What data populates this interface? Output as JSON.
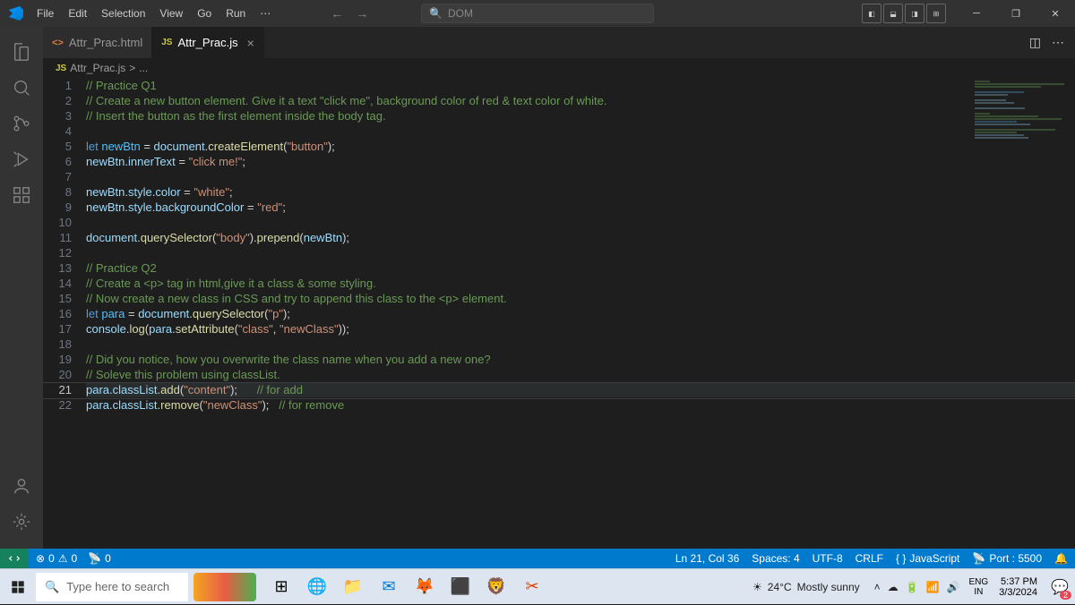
{
  "menu": [
    "File",
    "Edit",
    "Selection",
    "View",
    "Go",
    "Run"
  ],
  "search_placeholder": "DOM",
  "tabs": [
    {
      "icon": "html",
      "label": "Attr_Prac.html",
      "active": false
    },
    {
      "icon": "js",
      "label": "Attr_Prac.js",
      "active": true
    }
  ],
  "breadcrumb": {
    "file": "Attr_Prac.js",
    "sep": ">",
    "rest": "..."
  },
  "code": {
    "lines": [
      {
        "n": 1,
        "t": [
          [
            "cm",
            "// Practice Q1"
          ]
        ]
      },
      {
        "n": 2,
        "t": [
          [
            "cm",
            "// Create a new button element. Give it a text \"click me\", background color of red & text color of white."
          ]
        ]
      },
      {
        "n": 3,
        "t": [
          [
            "cm",
            "// Insert the button as the first element inside the body tag."
          ]
        ]
      },
      {
        "n": 4,
        "t": []
      },
      {
        "n": 5,
        "t": [
          [
            "kw",
            "let "
          ],
          [
            "lv",
            "newBtn"
          ],
          [
            "op",
            " = "
          ],
          [
            "vr",
            "document"
          ],
          [
            "pn",
            "."
          ],
          [
            "fn",
            "createElement"
          ],
          [
            "pn",
            "("
          ],
          [
            "st",
            "\"button\""
          ],
          [
            "pn",
            ");"
          ]
        ]
      },
      {
        "n": 6,
        "t": [
          [
            "vr",
            "newBtn"
          ],
          [
            "pn",
            "."
          ],
          [
            "vr",
            "innerText"
          ],
          [
            "op",
            " = "
          ],
          [
            "st",
            "\"click me!\""
          ],
          [
            "pn",
            ";"
          ]
        ]
      },
      {
        "n": 7,
        "t": []
      },
      {
        "n": 8,
        "t": [
          [
            "vr",
            "newBtn"
          ],
          [
            "pn",
            "."
          ],
          [
            "vr",
            "style"
          ],
          [
            "pn",
            "."
          ],
          [
            "vr",
            "color"
          ],
          [
            "op",
            " = "
          ],
          [
            "st",
            "\"white\""
          ],
          [
            "pn",
            ";"
          ]
        ]
      },
      {
        "n": 9,
        "t": [
          [
            "vr",
            "newBtn"
          ],
          [
            "pn",
            "."
          ],
          [
            "vr",
            "style"
          ],
          [
            "pn",
            "."
          ],
          [
            "vr",
            "backgroundColor"
          ],
          [
            "op",
            " = "
          ],
          [
            "st",
            "\"red\""
          ],
          [
            "pn",
            ";"
          ]
        ]
      },
      {
        "n": 10,
        "t": []
      },
      {
        "n": 11,
        "t": [
          [
            "vr",
            "document"
          ],
          [
            "pn",
            "."
          ],
          [
            "fn",
            "querySelector"
          ],
          [
            "pn",
            "("
          ],
          [
            "st",
            "\"body\""
          ],
          [
            "pn",
            ")."
          ],
          [
            "fn",
            "prepend"
          ],
          [
            "pn",
            "("
          ],
          [
            "vr",
            "newBtn"
          ],
          [
            "pn",
            ");"
          ]
        ]
      },
      {
        "n": 12,
        "t": []
      },
      {
        "n": 13,
        "t": [
          [
            "cm",
            "// Practice Q2"
          ]
        ]
      },
      {
        "n": 14,
        "t": [
          [
            "cm",
            "// Create a <p> tag in html,give it a class & some styling."
          ]
        ]
      },
      {
        "n": 15,
        "t": [
          [
            "cm",
            "// Now create a new class in CSS and try to append this class to the <p> element."
          ]
        ]
      },
      {
        "n": 16,
        "t": [
          [
            "kw",
            "let "
          ],
          [
            "lv",
            "para"
          ],
          [
            "op",
            " = "
          ],
          [
            "vr",
            "document"
          ],
          [
            "pn",
            "."
          ],
          [
            "fn",
            "querySelector"
          ],
          [
            "pn",
            "("
          ],
          [
            "st",
            "\"p\""
          ],
          [
            "pn",
            ");"
          ]
        ]
      },
      {
        "n": 17,
        "t": [
          [
            "vr",
            "console"
          ],
          [
            "pn",
            "."
          ],
          [
            "fn",
            "log"
          ],
          [
            "pn",
            "("
          ],
          [
            "vr",
            "para"
          ],
          [
            "pn",
            "."
          ],
          [
            "fn",
            "setAttribute"
          ],
          [
            "pn",
            "("
          ],
          [
            "st",
            "\"class\""
          ],
          [
            "pn",
            ", "
          ],
          [
            "st",
            "\"newClass\""
          ],
          [
            "pn",
            "));"
          ]
        ]
      },
      {
        "n": 18,
        "t": []
      },
      {
        "n": 19,
        "t": [
          [
            "cm",
            "// Did you notice, how you overwrite the class name when you add a new one?"
          ]
        ]
      },
      {
        "n": 20,
        "t": [
          [
            "cm",
            "// Soleve this problem using classList."
          ]
        ]
      },
      {
        "n": 21,
        "current": true,
        "t": [
          [
            "vr",
            "para"
          ],
          [
            "pn",
            "."
          ],
          [
            "vr",
            "classList"
          ],
          [
            "pn",
            "."
          ],
          [
            "fn",
            "add"
          ],
          [
            "pn",
            "("
          ],
          [
            "st",
            "\"content\""
          ],
          [
            "pn",
            ");      "
          ],
          [
            "cm",
            "// for add"
          ]
        ]
      },
      {
        "n": 22,
        "t": [
          [
            "vr",
            "para"
          ],
          [
            "pn",
            "."
          ],
          [
            "vr",
            "classList"
          ],
          [
            "pn",
            "."
          ],
          [
            "fn",
            "remove"
          ],
          [
            "pn",
            "("
          ],
          [
            "st",
            "\"newClass\""
          ],
          [
            "pn",
            ");   "
          ],
          [
            "cm",
            "// for remove"
          ]
        ]
      }
    ]
  },
  "status": {
    "errors": "0",
    "warnings": "0",
    "ports": "0",
    "ln_col": "Ln 21, Col 36",
    "spaces": "Spaces: 4",
    "encoding": "UTF-8",
    "eol": "CRLF",
    "lang": "JavaScript",
    "port": "Port : 5500"
  },
  "taskbar": {
    "search": "Type here to search",
    "weather_temp": "24°C",
    "weather_desc": "Mostly sunny",
    "lang_top": "ENG",
    "lang_bot": "IN",
    "time": "5:37 PM",
    "date": "3/3/2024",
    "notif_count": "2"
  }
}
